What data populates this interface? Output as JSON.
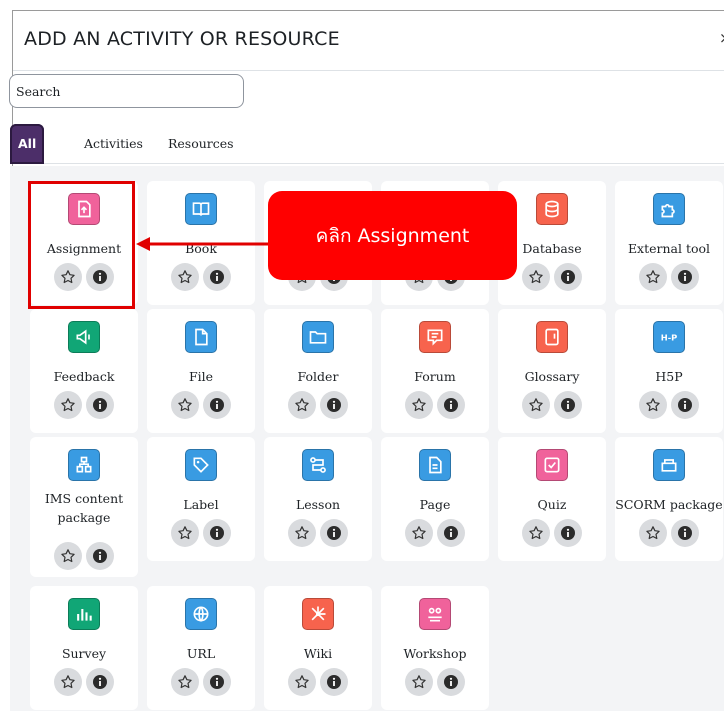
{
  "dialog": {
    "title": "ADD AN ACTIVITY OR RESOURCE",
    "close_symbol": "×"
  },
  "search": {
    "placeholder": "Search",
    "value": ""
  },
  "tabs": [
    {
      "label": "All",
      "active": true
    },
    {
      "label": "Activities",
      "active": false
    },
    {
      "label": "Resources",
      "active": false
    }
  ],
  "tiles": [
    {
      "label": "Assignment",
      "color": "#f0629b",
      "icon": "assignment-icon"
    },
    {
      "label": "Book",
      "color": "#399be2",
      "icon": "book-icon"
    },
    {
      "label": "",
      "color": "#399be2",
      "icon": "hidden-icon"
    },
    {
      "label": "",
      "color": "#399be2",
      "icon": "hidden-icon"
    },
    {
      "label": "Database",
      "color": "#f7634d",
      "icon": "database-icon"
    },
    {
      "label": "External tool",
      "color": "#399be2",
      "icon": "puzzle-icon"
    },
    {
      "label": "Feedback",
      "color": "#11a676",
      "icon": "megaphone-icon"
    },
    {
      "label": "File",
      "color": "#399be2",
      "icon": "file-icon"
    },
    {
      "label": "Folder",
      "color": "#399be2",
      "icon": "folder-icon"
    },
    {
      "label": "Forum",
      "color": "#f7634d",
      "icon": "forum-icon"
    },
    {
      "label": "Glossary",
      "color": "#f7634d",
      "icon": "glossary-icon"
    },
    {
      "label": "H5P",
      "color": "#399be2",
      "icon": "h5p-icon"
    },
    {
      "label": "IMS content package",
      "color": "#399be2",
      "icon": "package-icon"
    },
    {
      "label": "Label",
      "color": "#399be2",
      "icon": "tag-icon"
    },
    {
      "label": "Lesson",
      "color": "#399be2",
      "icon": "lesson-icon"
    },
    {
      "label": "Page",
      "color": "#399be2",
      "icon": "page-icon"
    },
    {
      "label": "Quiz",
      "color": "#f0629b",
      "icon": "quiz-icon"
    },
    {
      "label": "SCORM package",
      "color": "#399be2",
      "icon": "scorm-icon"
    },
    {
      "label": "Survey",
      "color": "#11a676",
      "icon": "survey-icon"
    },
    {
      "label": "URL",
      "color": "#399be2",
      "icon": "globe-icon"
    },
    {
      "label": "Wiki",
      "color": "#f7634d",
      "icon": "wiki-icon"
    },
    {
      "label": "Workshop",
      "color": "#f0629b",
      "icon": "workshop-icon"
    }
  ],
  "annotation": {
    "callout_text": "คลิก Assignment",
    "color": "#ff0000"
  }
}
